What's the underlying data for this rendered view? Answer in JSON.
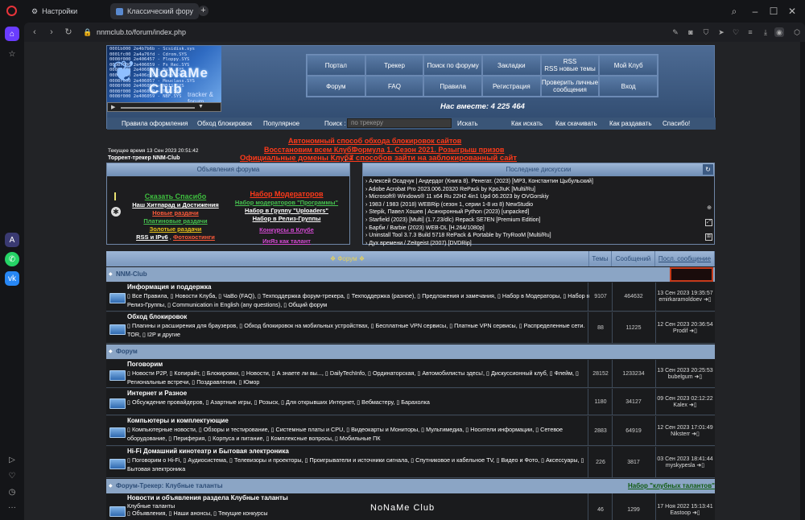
{
  "browser": {
    "tabs": [
      {
        "label": "Настройки",
        "icon": "gear-icon"
      },
      {
        "label": "Классический форум-тр",
        "icon": "site-favicon"
      }
    ],
    "url": "nnmclub.to/forum/index.php",
    "sidebar": [
      "opera-logo-icon",
      "home-icon",
      "cube-icon",
      "star-icon",
      "aria-icon",
      "whatsapp-icon",
      "vk-icon",
      "play-icon",
      "heart-icon",
      "history-icon",
      "more-icon"
    ]
  },
  "header": {
    "logo_text": "NoNaMe Club",
    "logo_sub": "tracker & forum",
    "logo_lines": [
      "0001b000 2e4b7b6b - Scsidisk.sys",
      "0001fc00 2a4a76fd - Cdrom.SYS",
      "0008f000 2e406457 - Floppy.SYS",
      "0008f000 2e406659 - Fs_Rec.SYS",
      "0008f000 2e406659 - Null.SYS",
      "0008f000 2e406c59 - Beep.SYS",
      "0008f000 2e406057 - Mouclass.SYS",
      "0008f000 2e406059 - NDIS.SYS",
      "0008f000 2e406059 - TDI.SYS",
      "0008f000 2e406059 - NBF.SYS"
    ],
    "nav": [
      [
        "Портал",
        "Трекер",
        "Поиск по форуму",
        "Закладки",
        "RSS\nRSS новые темы",
        "Мой Клуб"
      ],
      [
        "Форум",
        "FAQ",
        "Правила",
        "Регистрация",
        "Проверить личные сообщения",
        "Вход"
      ]
    ],
    "online": "Нас вместе: 4 225 464",
    "menu": {
      "rules": "Правила оформления",
      "bypass": "Обход блокировок",
      "popular": "Популярное",
      "search_label": "Поиск :",
      "search_placeholder": "по трекеру",
      "search_btn": "Искать",
      "how_search": "Как искать",
      "how_download": "Как скачивать",
      "how_seed": "Как раздавать",
      "thanks": "Спасибо!"
    }
  },
  "notices": {
    "line1": "Автономный способ обхода блокировок сайтов",
    "line2a": "Восстановим всем Клуб!",
    "line2b": "Формула 1. Сезон 2021. Розыгрыш призов",
    "line3a": "Официальные домены Клуба",
    "line3b": "7 способов зайти на заблокированный сайт",
    "time": "Текущее время 13 Сен 2023 20:51:42",
    "tracker": "Торрент-трекер NNM-Club"
  },
  "announce": {
    "title": "Объявления форума",
    "items": [
      {
        "t": "Сказать Спасибо",
        "c": "#3fbf3f"
      },
      {
        "t": "Наш Хитпарад и Достижения",
        "c": "#ffffff"
      },
      {
        "t": "Новые раздачи",
        "c": "#ff5a3a"
      },
      {
        "t": "Платиновые раздачи",
        "c": "#46c24f"
      },
      {
        "t": "Золотые раздачи",
        "c": "#e8c21a"
      },
      {
        "t": "RSS и IPv6",
        "c": "#ffffff"
      },
      {
        "t": "Фотохостинги",
        "c": "#ff5a3a"
      },
      {
        "t": "Набор Модераторов",
        "c": "#ff3a1a"
      },
      {
        "t": "Набор модераторов \"Программы\"",
        "c": "#46c24f"
      },
      {
        "t": "Набор в Группу \"Uploaders\"",
        "c": "#ffffff"
      },
      {
        "t": "Набор в Релиз-Группы",
        "c": "#ffffff"
      },
      {
        "t": "Конкурсы в Клубе",
        "c": "#d44ad4"
      },
      {
        "t": "ИнЯз как талант",
        "c": "#d44ad4"
      }
    ]
  },
  "discussions": {
    "title": "Последние дискуссии",
    "items": [
      "Алексей Осадчук | Андердог (Книга 8). Ренегат. (2023) [MP3, Константин Цыбульский]",
      "Adobe Acrobat Pro 2023.006.20320 RePack by KpoJIuK [Multi/Ru]",
      "Microsoft® Windows® 11 x64 Ru 22H2 4in1 Upd 06.2023 by OVGorskiy",
      "1983 / 1983 (2018) WEBRip (сезон 1, серии 1-8 из 8) NewStudio",
      "Stepik, Павел Хошев | Асинхронный Python (2023) [unpacked]",
      "Starfield (2023) [Multi] (1.7.23/dlc) Repack SE7EN [Premium Edition]",
      "Барби / Barbie (2023) WEB-DL [H.264/1080p]",
      "Uninstall Tool 3.7.3 Build 5718 RePack & Portable by TryRooM [Multi/Ru]",
      "Дух времени / Zeitgeist (2007) [DVDRip]"
    ]
  },
  "forum": {
    "col_forum": "❖ Форум ❖",
    "col_topics": "Темы",
    "col_posts": "Сообщений",
    "col_last": "Посл. сообщение",
    "cat1": "NNM-Club",
    "cat2": "Форум",
    "cat3": "Форум-Трекер: Клубные таланты",
    "cat3_link": "Набор \"клубных талантов\"",
    "rows": [
      {
        "title": "Информация и поддержка",
        "sub": "Все Правила, Новости Клуба, ЧаВо (FAQ), Техподдержка форум-трекера, Техподдержка (разное), Предложения и замечания, Набор в Модераторы, Набор в Релиз-Группы, Communication in English (any questions), Общий форум",
        "topics": "9107",
        "posts": "464632",
        "date": "13 Сен 2023 19:35:57",
        "user": "emirkaramoldoev"
      },
      {
        "title": "Обход блокировок",
        "sub": "Плагины и расширения для браузеров, Обход блокировок на мобильных устройствах, Бесплатные VPN сервисы, Платные VPN сервисы, Распределенные сети. TOR, I2P и другие",
        "topics": "88",
        "posts": "11225",
        "date": "12 Сен 2023 20:36:54",
        "user": "Prodif"
      },
      {
        "title": "Поговорим",
        "sub": "Новости P2P, Копирайт, Блокировки, Новости, А знаете ли вы..., DailyTechInfo, Ординаторская, Автомобилисты здесь!, Дискуссионный клуб, Флейм, Региональные встречи, Поздравления, Юмор",
        "topics": "28152",
        "posts": "1233234",
        "date": "13 Сен 2023 20:25:53",
        "user": "bubelgum"
      },
      {
        "title": "Интернет и Разное",
        "sub": "Обсуждение провайдеров, Азартные игры, Розыск, Для открывших Интернет, Вебмастеру, Барахолка",
        "topics": "1180",
        "posts": "34127",
        "date": "09 Сен 2023 02:12:22",
        "user": "Kalex"
      },
      {
        "title": "Компьютеры и комплектующие",
        "sub": "Компьютерные новости, Обзоры и тестирование, Системные платы и CPU, Видеокарты и Мониторы, Мультимедиа, Носители информации, Сетевое оборудование, Периферия, Корпуса и питание, Комплексные вопросы, Мобильные ПК",
        "topics": "2883",
        "posts": "64919",
        "date": "12 Сен 2023 17:01:49",
        "user": "Niksterr"
      },
      {
        "title": "Hi-Fi Домашний кинотеатр и Бытовая электроника",
        "sub": "Поговорим о Hi-Fi, Аудиосистема, Телевизоры и проекторы, Проигрыватели и источники сигнала, Спутниковое и кабельное TV, Видео и Фото, Аксессуары, Бытовая электроника",
        "topics": "226",
        "posts": "3817",
        "date": "03 Сен 2023 18:41:44",
        "user": "myskypesla"
      },
      {
        "title": "Новости и объявления раздела Клубные таланты",
        "sub": "Клубные таланты",
        "sub2": "Объявления, Наши анонсы, Текущие конкурсы",
        "topics": "46",
        "posts": "1299",
        "date": "17 Ноя 2022 15:13:41",
        "user": "Eastoop"
      }
    ],
    "watermark": "NoNaMe Club"
  }
}
